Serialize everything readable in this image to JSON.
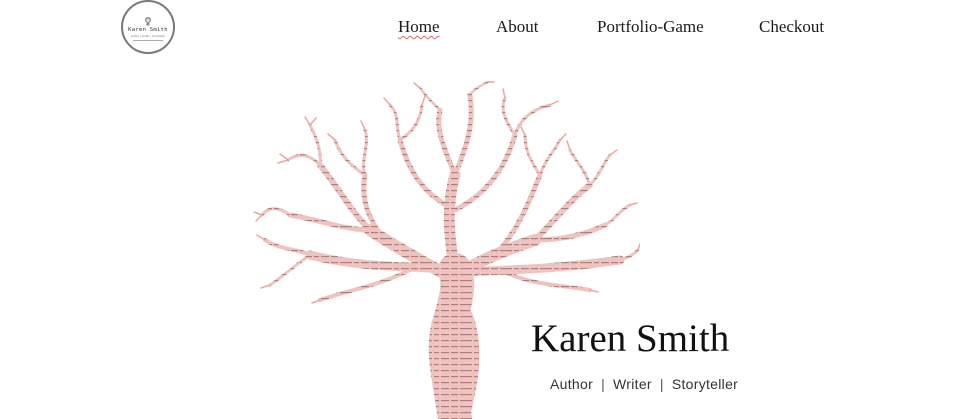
{
  "brand": {
    "logo_name": "Karen Smith",
    "logo_sub": "author | writer | storyteller"
  },
  "nav": {
    "items": [
      {
        "label": "Home",
        "active": true
      },
      {
        "label": "About",
        "active": false
      },
      {
        "label": "Portfolio-Game",
        "active": false
      },
      {
        "label": "Checkout",
        "active": false
      }
    ]
  },
  "hero": {
    "name": "Karen Smith",
    "tagline": [
      "Author",
      "Writer",
      "Storyteller"
    ],
    "separator": "|"
  },
  "colors": {
    "tree": "#e9b3ae",
    "tree_text": "#3a2a28",
    "accent_underline": "#c96a6a"
  }
}
